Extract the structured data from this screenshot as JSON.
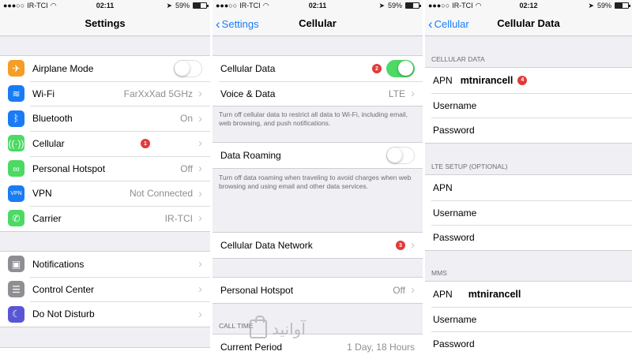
{
  "status": {
    "p1": {
      "carrier": "IR-TCI",
      "time": "02:11",
      "battery": "59%"
    },
    "p2": {
      "carrier": "IR-TCI",
      "time": "02:11",
      "battery": "59%"
    },
    "p3": {
      "carrier": "IR-TCI",
      "time": "02:12",
      "battery": "59%"
    },
    "battery_level": 0.59
  },
  "settings": {
    "title": "Settings",
    "rows": [
      {
        "label": "Airplane Mode",
        "icon_color": "#f59d24"
      },
      {
        "label": "Wi-Fi",
        "value": "FarXxXad 5GHz",
        "icon_color": "#1a7cf5"
      },
      {
        "label": "Bluetooth",
        "value": "On",
        "icon_color": "#1a7cf5"
      },
      {
        "label": "Cellular",
        "badge": "1",
        "icon_color": "#4cd964"
      },
      {
        "label": "Personal Hotspot",
        "value": "Off",
        "icon_color": "#4cd964"
      },
      {
        "label": "VPN",
        "value": "Not Connected",
        "icon_color": "#1a7cf5",
        "icon_text": "VPN"
      },
      {
        "label": "Carrier",
        "value": "IR-TCI",
        "icon_color": "#4cd964"
      }
    ],
    "rows2": [
      {
        "label": "Notifications",
        "icon_color": "#8e8e93"
      },
      {
        "label": "Control Center",
        "icon_color": "#8e8e93"
      },
      {
        "label": "Do Not Disturb",
        "icon_color": "#5856d6"
      }
    ]
  },
  "cellular": {
    "back": "Settings",
    "title": "Cellular",
    "cellular_data": {
      "label": "Cellular Data",
      "badge": "2"
    },
    "voice_data": {
      "label": "Voice & Data",
      "value": "LTE"
    },
    "footer1": "Turn off cellular data to restrict all data to Wi-Fi, including email, web browsing, and push notifications.",
    "roaming": {
      "label": "Data Roaming"
    },
    "footer2": "Turn off data roaming when traveling to avoid charges when web browsing and using email and other data services.",
    "network": {
      "label": "Cellular Data Network",
      "badge": "3"
    },
    "hotspot": {
      "label": "Personal Hotspot",
      "value": "Off"
    },
    "call_time_header": "CALL TIME",
    "current_period": {
      "label": "Current Period",
      "value": "1 Day, 18 Hours"
    }
  },
  "cellular_data": {
    "back": "Cellular",
    "title": "Cellular Data",
    "sections": [
      {
        "header": "CELLULAR DATA",
        "apn_label": "APN",
        "apn_value": "mtnirancell",
        "badge": "4",
        "username_label": "Username",
        "password_label": "Password"
      },
      {
        "header": "LTE SETUP (OPTIONAL)",
        "apn_label": "APN",
        "apn_value": "",
        "username_label": "Username",
        "password_label": "Password"
      },
      {
        "header": "MMS",
        "apn_label": "APN",
        "apn_value": "mtnirancell",
        "username_label": "Username",
        "password_label": "Password"
      }
    ]
  },
  "toggles": {
    "airplane_mode": false,
    "cellular_data": true,
    "data_roaming": false
  },
  "colors": {
    "accent": "#1a7cf5",
    "toggle_on": "#4cd964",
    "badge": "#e23a3a"
  },
  "watermark": {
    "text": "آوانید"
  }
}
